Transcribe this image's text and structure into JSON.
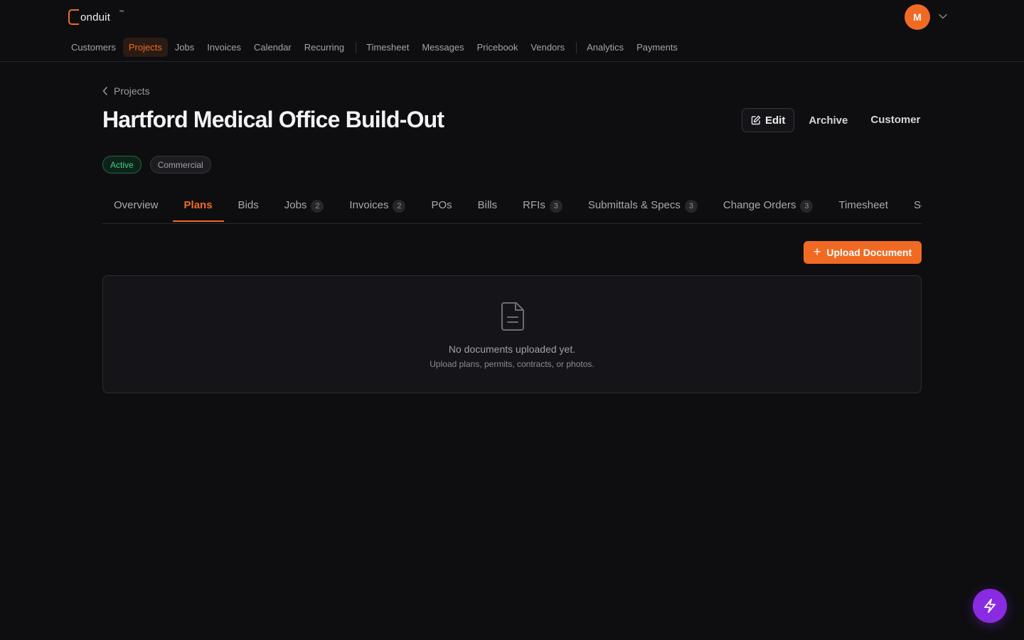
{
  "app": {
    "logo_text": "onduit",
    "logo_tm": "™",
    "avatar_initial": "M"
  },
  "nav": {
    "items": [
      "Customers",
      "Projects",
      "Jobs",
      "Invoices",
      "Calendar",
      "Recurring",
      "Timesheet",
      "Messages",
      "Pricebook",
      "Vendors",
      "Analytics",
      "Payments"
    ],
    "active": "Projects"
  },
  "breadcrumb": {
    "label": "Projects"
  },
  "page": {
    "title": "Hartford Medical Office Build-Out",
    "actions": {
      "edit": "Edit",
      "archive": "Archive",
      "customer": "Customer"
    },
    "badges": {
      "status": "Active",
      "type": "Commercial"
    }
  },
  "tabs": [
    {
      "label": "Overview",
      "count": ""
    },
    {
      "label": "Plans",
      "count": ""
    },
    {
      "label": "Bids",
      "count": ""
    },
    {
      "label": "Jobs",
      "count": "2"
    },
    {
      "label": "Invoices",
      "count": "2"
    },
    {
      "label": "POs",
      "count": ""
    },
    {
      "label": "Bills",
      "count": ""
    },
    {
      "label": "RFIs",
      "count": "3"
    },
    {
      "label": "Submittals & Specs",
      "count": "3"
    },
    {
      "label": "Change Orders",
      "count": "3"
    },
    {
      "label": "Timesheet",
      "count": ""
    },
    {
      "label": "Schedule",
      "count": ""
    }
  ],
  "active_tab": "Plans",
  "documents": {
    "upload_label": "Upload Document",
    "empty_title": "No documents uploaded yet.",
    "empty_subtitle": "Upload plans, permits, contracts, or photos."
  },
  "colors": {
    "accent": "#f06a24",
    "status_active": "#3ed18a",
    "fab": "#8a2be2",
    "background": "#0e0e11"
  },
  "icons": {
    "back": "chevron-left-icon",
    "edit": "edit-icon",
    "account_menu": "chevron-down-icon",
    "empty_state": "document-icon",
    "fab": "lightning-icon"
  }
}
